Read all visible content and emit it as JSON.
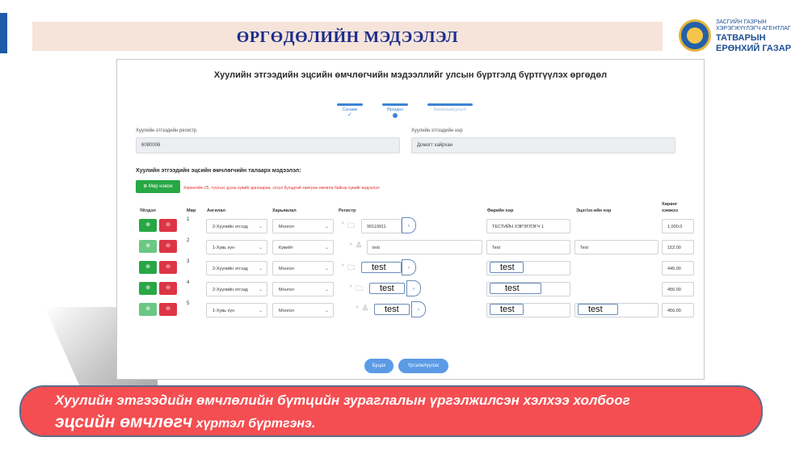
{
  "slide": {
    "title": "ӨРГӨДӨЛИЙН МЭДЭЭЛЭЛ",
    "logo": {
      "line1": "ЗАСГИЙН ГАЗРЫН",
      "line2": "ХЭРЭГЖҮҮЛЭГЧ АГЕНТЛАГ",
      "line3": "ТАТВАРЫН",
      "line4": "ЕРӨНХИЙ ГАЗАР"
    },
    "callout": {
      "line1": "Хуулийн этгээдийн өмчлөлийн бүтцийн зураглалын үргэлжилсэн хэлхээ холбоог",
      "line2_emphasis": "эцсийн өмчлөгч",
      "line2_rest": " хүртэл бүртгэнэ."
    }
  },
  "form": {
    "title": "Хуулийн этгээдийн эцсийн өмчлөгчийн мэдээллийг улсын бүртгэлд бүртгүүлэх өргөдөл",
    "steps": [
      {
        "label": "Санамж",
        "mark": "✓"
      },
      {
        "label": "Өргөдөл"
      },
      {
        "label": "Баталгаажуулалт"
      }
    ],
    "register_label": "Хуулийн этгээдийн регистр",
    "register_value": "6080006",
    "name_label": "Хуулийн этгээдийн нэр",
    "name_value": "Домогт хайрхан",
    "section_title": "Хуулийн этгээдийн эцсийн өмчлөгчийн талаарх мэдээлэл:",
    "add_button": "⊕ Мөр нэмэх",
    "warning": "Хөрөнгийн 25, түүнээс дээш хувийг дангаараа, эсхүл бусадтай хамтран өмчилж байгаа хувийг мэдээлэл",
    "columns": {
      "actions": "Үйлдэл",
      "row": "Мөр",
      "type": "Ангилал",
      "citizenship": "Харьяалал",
      "register": "Регистр",
      "family_name": "Өөрийн нэр",
      "parent_name": "Эцэг/эх-ийн нэр",
      "share_l1": "Хөрөнг",
      "share_l2": "хэмжээ"
    },
    "rows": [
      {
        "num": "1",
        "type": "2-Хуулийн этгээд",
        "citizenship": "Монгол",
        "register": "99119911",
        "name": "ТЕСТИЙН ХЭРЭГЛЭГЧ 1",
        "parent": "",
        "share": "1,000.0"
      },
      {
        "num": "2",
        "type": "1-Хувь хүн",
        "citizenship": "Кувейт",
        "register": "test",
        "name": "Test",
        "parent": "Test",
        "share": "152.00"
      },
      {
        "num": "3",
        "type": "2-Хуулийн этгээд",
        "citizenship": "Монгол",
        "register": "test",
        "name": "test",
        "parent": "",
        "share": "445.00"
      },
      {
        "num": "4",
        "type": "2-Хуулийн этгээд",
        "citizenship": "Монгол",
        "register": "test",
        "name": "test",
        "parent": "",
        "share": "456.00"
      },
      {
        "num": "5",
        "type": "1-Хувь хүн",
        "citizenship": "Монгол",
        "register": "test",
        "name": "test",
        "parent": "test",
        "share": "456.00"
      }
    ],
    "back_button": "Буцах",
    "continue_button": "Үргэлжлүүлэх"
  },
  "colors": {
    "title_text": "#1c2c8c",
    "primary_blue": "#3d84d4",
    "success": "#28a745",
    "danger": "#dc3545",
    "callout": "#f44e52"
  }
}
